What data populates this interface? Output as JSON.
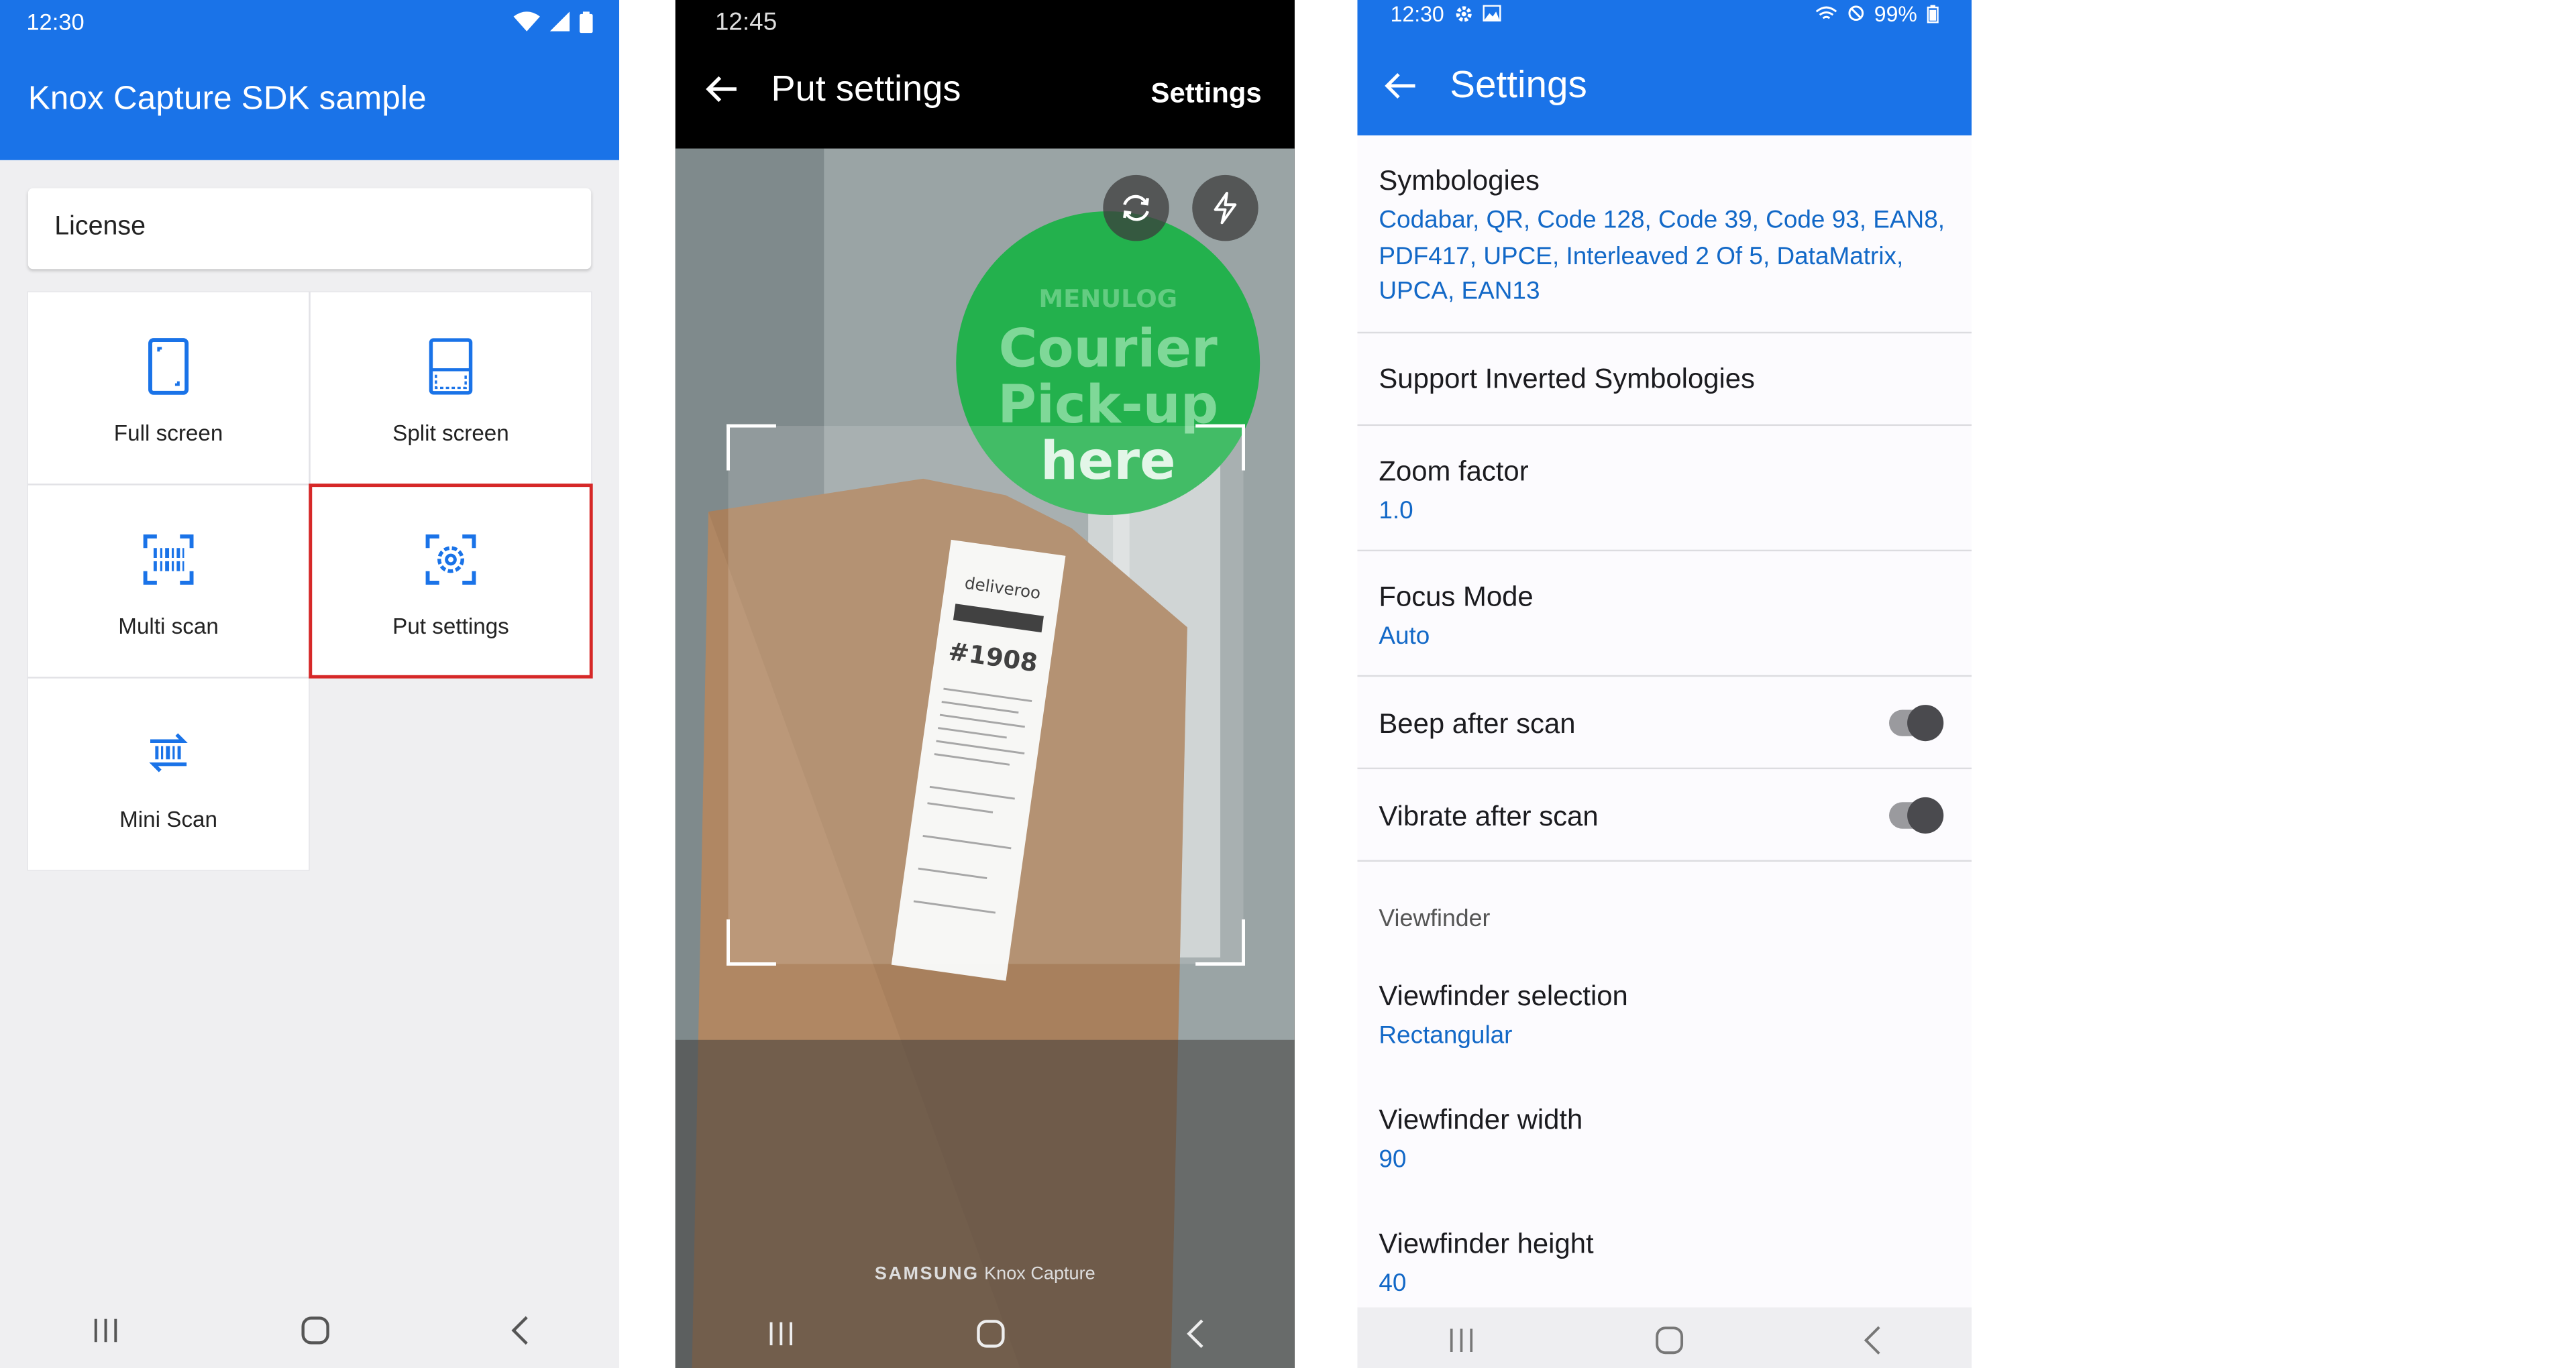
{
  "panel_a": {
    "status_time": "12:30",
    "app_title": "Knox Capture SDK sample",
    "license_label": "License",
    "tiles": [
      {
        "label": "Full screen",
        "icon": "phone-portrait-icon"
      },
      {
        "label": "Split screen",
        "icon": "split-screen-icon"
      },
      {
        "label": "Multi scan",
        "icon": "barcode-scan-icon"
      },
      {
        "label": "Put settings",
        "icon": "gear-scan-icon"
      },
      {
        "label": "Mini Scan",
        "icon": "barcode-refresh-icon"
      }
    ],
    "highlight_color": "#d62828"
  },
  "panel_b": {
    "status_time": "12:45",
    "title": "Put settings",
    "settings_link": "Settings",
    "brand_prefix": "SAMSUNG",
    "brand_suffix": "Knox Capture"
  },
  "panel_c": {
    "status_time": "12:30",
    "battery": "99%",
    "title": "Settings",
    "prefs": [
      {
        "title": "Symbologies",
        "summary": "Codabar, QR, Code 128, Code 39, Code 93, EAN8, PDF417, UPCE, Interleaved 2 Of 5, DataMatrix, UPCA, EAN13"
      },
      {
        "title": "Support Inverted Symbologies"
      },
      {
        "title": "Zoom factor",
        "summary": "1.0"
      },
      {
        "title": "Focus Mode",
        "summary": "Auto"
      },
      {
        "title": "Beep after scan",
        "toggle": true
      },
      {
        "title": "Vibrate after scan",
        "toggle": true
      },
      {
        "title": "Viewfinder selection",
        "summary": "Rectangular"
      },
      {
        "title": "Viewfinder width",
        "summary": "90"
      },
      {
        "title": "Viewfinder height",
        "summary": "40"
      }
    ],
    "section_header": "Viewfinder"
  },
  "colors": {
    "primary": "#1a73e8",
    "link": "#1268c7"
  }
}
